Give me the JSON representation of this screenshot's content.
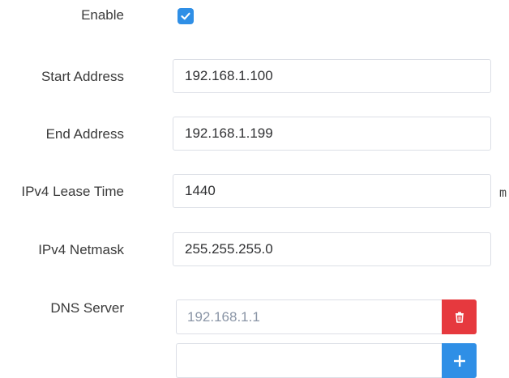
{
  "form": {
    "enable_label": "Enable",
    "enable_checked": true,
    "start_address_label": "Start Address",
    "start_address_value": "192.168.1.100",
    "end_address_label": "End Address",
    "end_address_value": "192.168.1.199",
    "lease_time_label": "IPv4 Lease Time",
    "lease_time_value": "1440",
    "lease_time_unit": "m",
    "netmask_label": "IPv4 Netmask",
    "netmask_value": "255.255.255.0",
    "dns_label": "DNS Server",
    "dns_servers": [
      {
        "placeholder": "192.168.1.1",
        "value": "",
        "action": "delete-icon"
      },
      {
        "placeholder": "",
        "value": "",
        "action": "plus-icon"
      }
    ]
  },
  "colors": {
    "accent": "#2f8fe6",
    "danger": "#e6393e",
    "add": "#2f8fe6"
  }
}
